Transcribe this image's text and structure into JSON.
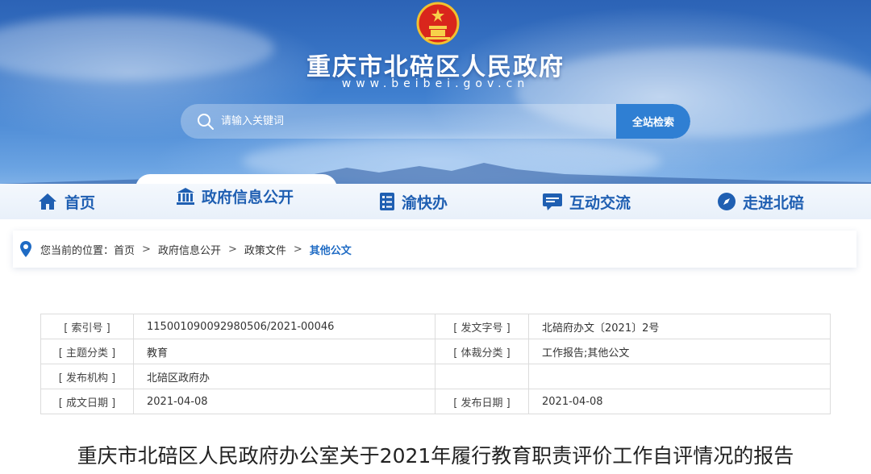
{
  "site": {
    "title": "重庆市北碚区人民政府",
    "domain": "www.beibei.gov.cn"
  },
  "search": {
    "placeholder": "请输入关键词",
    "button_label": "全站检索"
  },
  "nav": {
    "items": [
      {
        "label": "首页",
        "icon": "home-icon"
      },
      {
        "label": "政府信息公开",
        "icon": "government-building-icon"
      },
      {
        "label": "渝快办",
        "icon": "checklist-icon"
      },
      {
        "label": "互动交流",
        "icon": "chat-icon"
      },
      {
        "label": "走进北碚",
        "icon": "compass-icon"
      }
    ],
    "active_index": 1
  },
  "breadcrumb": {
    "prefix": "您当前的位置：",
    "items": [
      "首页",
      "政府信息公开",
      "政策文件",
      "其他公文"
    ]
  },
  "info": {
    "index_label": "[ 索引号 ]",
    "index_value": "11500109009298050​6/2021-00046",
    "doc_no_label": "[ 发文字号 ]",
    "doc_no_value": "北碚府办文〔2021〕2号",
    "topic_label": "[ 主题分类 ]",
    "topic_value": "教育",
    "genre_label": "[ 体裁分类 ]",
    "genre_value": "工作报告;其他公文",
    "org_label": "[ 发布机构 ]",
    "org_value": "北碚区政府办",
    "created_label": "[ 成文日期 ]",
    "created_value": "2021-04-08",
    "published_label": "[ 发布日期 ]",
    "published_value": "2021-04-08"
  },
  "document": {
    "title": "重庆市北碚区人民政府办公室关于2021年履行教育职责评价工作自评情况的报告"
  },
  "colors": {
    "accent": "#1f5fb2",
    "search_button": "#2f7fd3",
    "crumb_current": "#1f6bc4"
  }
}
